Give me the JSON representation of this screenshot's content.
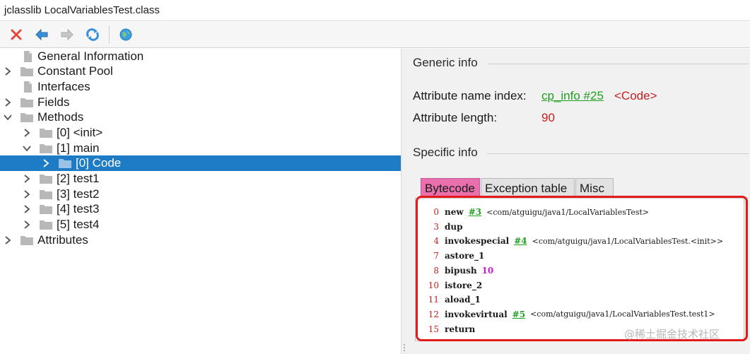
{
  "window": {
    "title": "jclasslib LocalVariablesTest.class"
  },
  "toolbar": {
    "buttons": [
      {
        "icon": "close-icon",
        "color": "#e04a3a"
      },
      {
        "icon": "back-arrow-icon",
        "color": "#3a8fd8"
      },
      {
        "icon": "forward-arrow-icon",
        "color": "#b0b0b0"
      },
      {
        "icon": "refresh-icon",
        "color": "#3a8fd8"
      },
      {
        "icon": "web-globe-icon",
        "color": "#3a8fd8"
      }
    ]
  },
  "tree": {
    "items": [
      {
        "label": "General Information",
        "type": "file",
        "expander": "none"
      },
      {
        "label": "Constant Pool",
        "type": "folder",
        "expander": "collapsed"
      },
      {
        "label": "Interfaces",
        "type": "file",
        "expander": "none"
      },
      {
        "label": "Fields",
        "type": "folder",
        "expander": "collapsed"
      },
      {
        "label": "Methods",
        "type": "folder",
        "expander": "expanded"
      },
      {
        "label": "[0] <init>",
        "type": "folder",
        "expander": "collapsed"
      },
      {
        "label": "[1] main",
        "type": "folder",
        "expander": "expanded"
      },
      {
        "label": "[0] Code",
        "type": "folder",
        "expander": "collapsed",
        "selected": true
      },
      {
        "label": "[2] test1",
        "type": "folder",
        "expander": "collapsed"
      },
      {
        "label": "[3] test2",
        "type": "folder",
        "expander": "collapsed"
      },
      {
        "label": "[4] test3",
        "type": "folder",
        "expander": "collapsed"
      },
      {
        "label": "[5] test4",
        "type": "folder",
        "expander": "collapsed"
      },
      {
        "label": "Attributes",
        "type": "folder",
        "expander": "collapsed"
      }
    ]
  },
  "generic_info": {
    "title": "Generic info",
    "name_index_label": "Attribute name index:",
    "name_index_link": "cp_info #25",
    "name_index_value": "<Code>",
    "length_label": "Attribute length:",
    "length_value": "90"
  },
  "specific_info": {
    "title": "Specific info",
    "tabs": [
      {
        "label": "Bytecode",
        "active": true
      },
      {
        "label": "Exception table",
        "active": false
      },
      {
        "label": "Misc",
        "active": false
      }
    ],
    "bytecode": [
      {
        "offset": "0",
        "op": "new",
        "ref": "#3",
        "comment": "<com/atguigu/java1/LocalVariablesTest>"
      },
      {
        "offset": "3",
        "op": "dup"
      },
      {
        "offset": "4",
        "op": "invokespecial",
        "ref": "#4",
        "comment": "<com/atguigu/java1/LocalVariablesTest.<init>>"
      },
      {
        "offset": "7",
        "op": "astore_1"
      },
      {
        "offset": "8",
        "op": "bipush",
        "int": "10"
      },
      {
        "offset": "10",
        "op": "istore_2"
      },
      {
        "offset": "11",
        "op": "aload_1"
      },
      {
        "offset": "12",
        "op": "invokevirtual",
        "ref": "#5",
        "comment": "<com/atguigu/java1/LocalVariablesTest.test1>"
      },
      {
        "offset": "15",
        "op": "return"
      }
    ]
  },
  "watermark": "@稀土掘金技术社区",
  "colors": {
    "selection": "#1e7bc6",
    "link_green": "#1f9e1f",
    "value_red": "#c81e1e",
    "active_tab": "#e96fad",
    "highlight_frame": "#e41b1b"
  }
}
